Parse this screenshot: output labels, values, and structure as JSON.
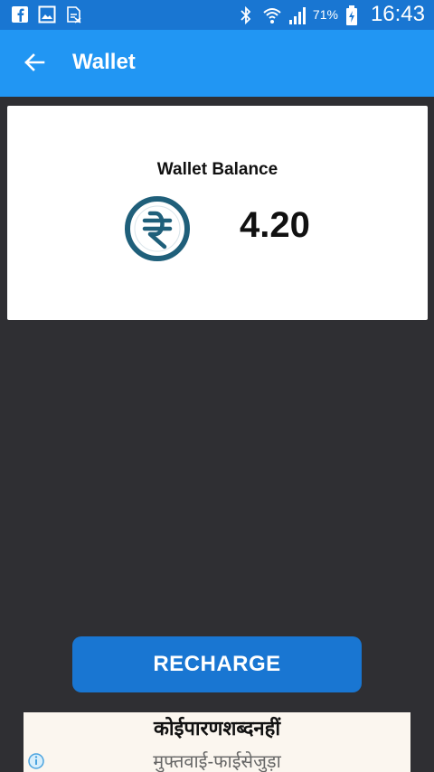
{
  "status_bar": {
    "battery": "71%",
    "time": "16:43",
    "icons": [
      "facebook-icon",
      "gallery-icon",
      "notification-icon",
      "bluetooth-icon",
      "wifi-icon",
      "signal-icon",
      "battery-icon"
    ]
  },
  "app_bar": {
    "title": "Wallet",
    "back_icon": "arrow-back-icon"
  },
  "wallet": {
    "label": "Wallet Balance",
    "amount": "4.20",
    "currency_icon": "rupee-icon"
  },
  "actions": {
    "recharge_label": "RECHARGE"
  },
  "ad": {
    "line1": "कोईपारणशब्दनहीं",
    "line2": "मुफ्तवाई-फाईसेजुड़ा",
    "info_icon": "info-icon"
  },
  "colors": {
    "status_bar": "#1976d2",
    "app_bar": "#2196f3",
    "background": "#2f2f33",
    "rupee_ring": "#1f5f7a",
    "button": "#1976d2"
  }
}
